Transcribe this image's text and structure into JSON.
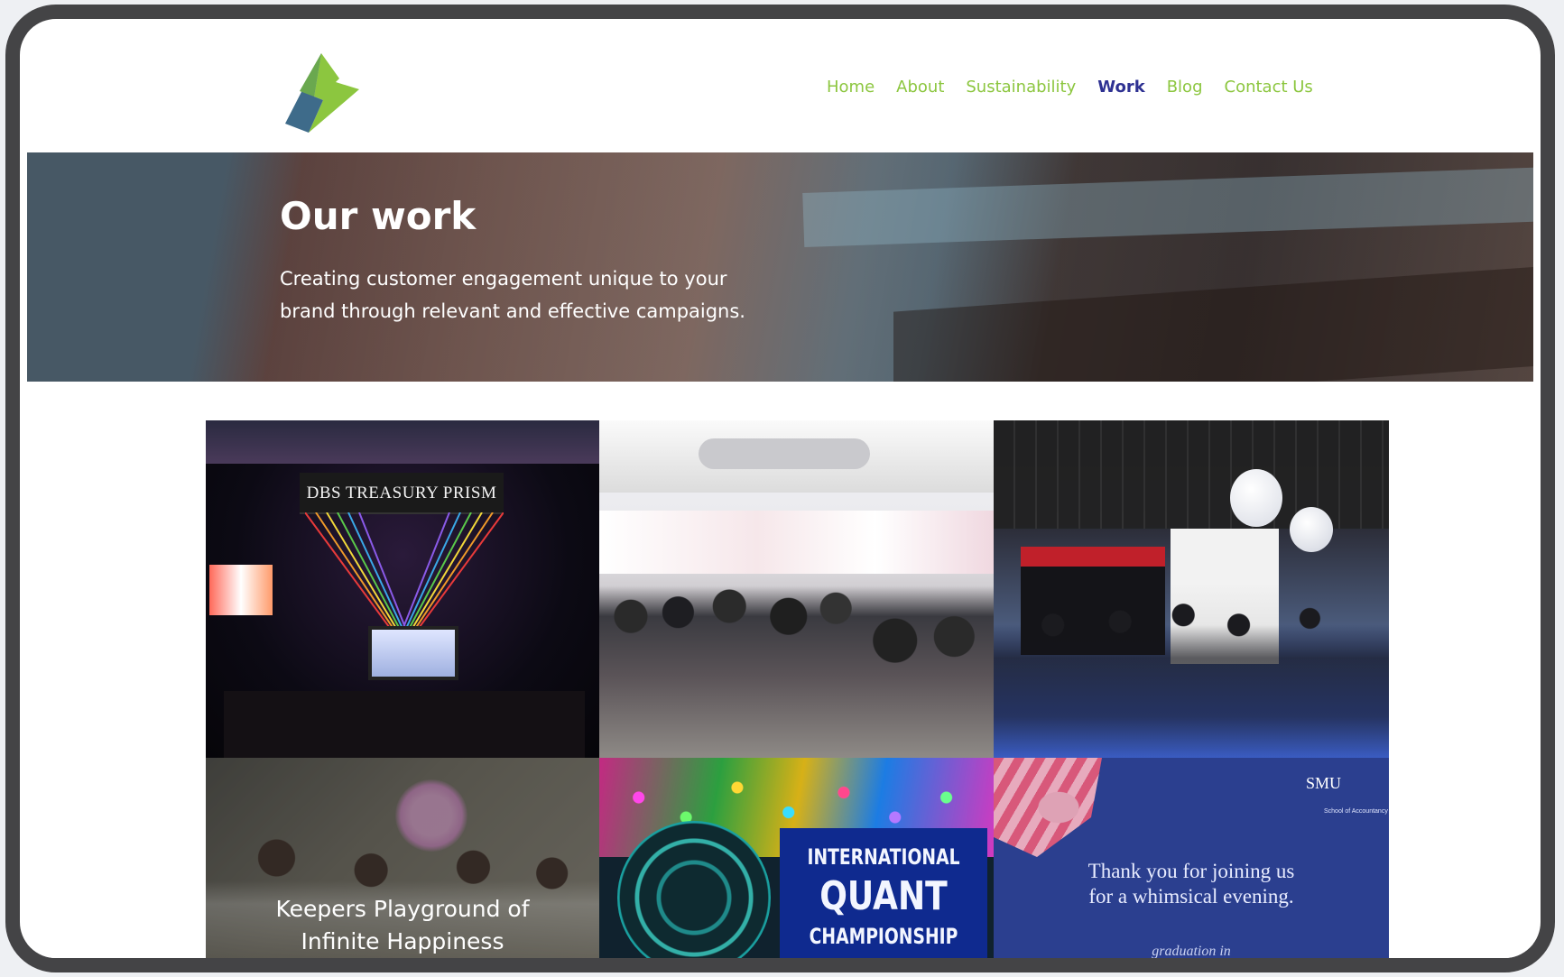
{
  "nav": {
    "items": [
      {
        "label": "Home",
        "active": false
      },
      {
        "label": "About",
        "active": false
      },
      {
        "label": "Sustainability",
        "active": false
      },
      {
        "label": "Work",
        "active": true
      },
      {
        "label": "Blog",
        "active": false
      },
      {
        "label": "Contact Us",
        "active": false
      }
    ]
  },
  "hero": {
    "title": "Our work",
    "subtitle": "Creating customer engagement unique to your brand through relevant and effective campaigns."
  },
  "gallery": {
    "tiles": [
      {
        "banner": "DBS TREASURY PRISM"
      },
      {
        "description": ""
      },
      {
        "description": ""
      },
      {
        "caption_line1": "Keepers Playground of",
        "caption_line2": "Infinite Happiness"
      },
      {
        "line1": "INTERNATIONAL",
        "line2": "QUANT",
        "line3": "CHAMPIONSHIP"
      },
      {
        "logo": "SMU",
        "logo_sub": "School of Accountancy",
        "line1": "Thank you for joining us",
        "line2": "for a whimsical evening.",
        "script": "graduation in"
      }
    ]
  },
  "colors": {
    "nav_text": "#8cc63f",
    "nav_active": "#2e3192",
    "frame": "#444446"
  },
  "icons": {
    "logo": "lightning-bolt-logo"
  }
}
